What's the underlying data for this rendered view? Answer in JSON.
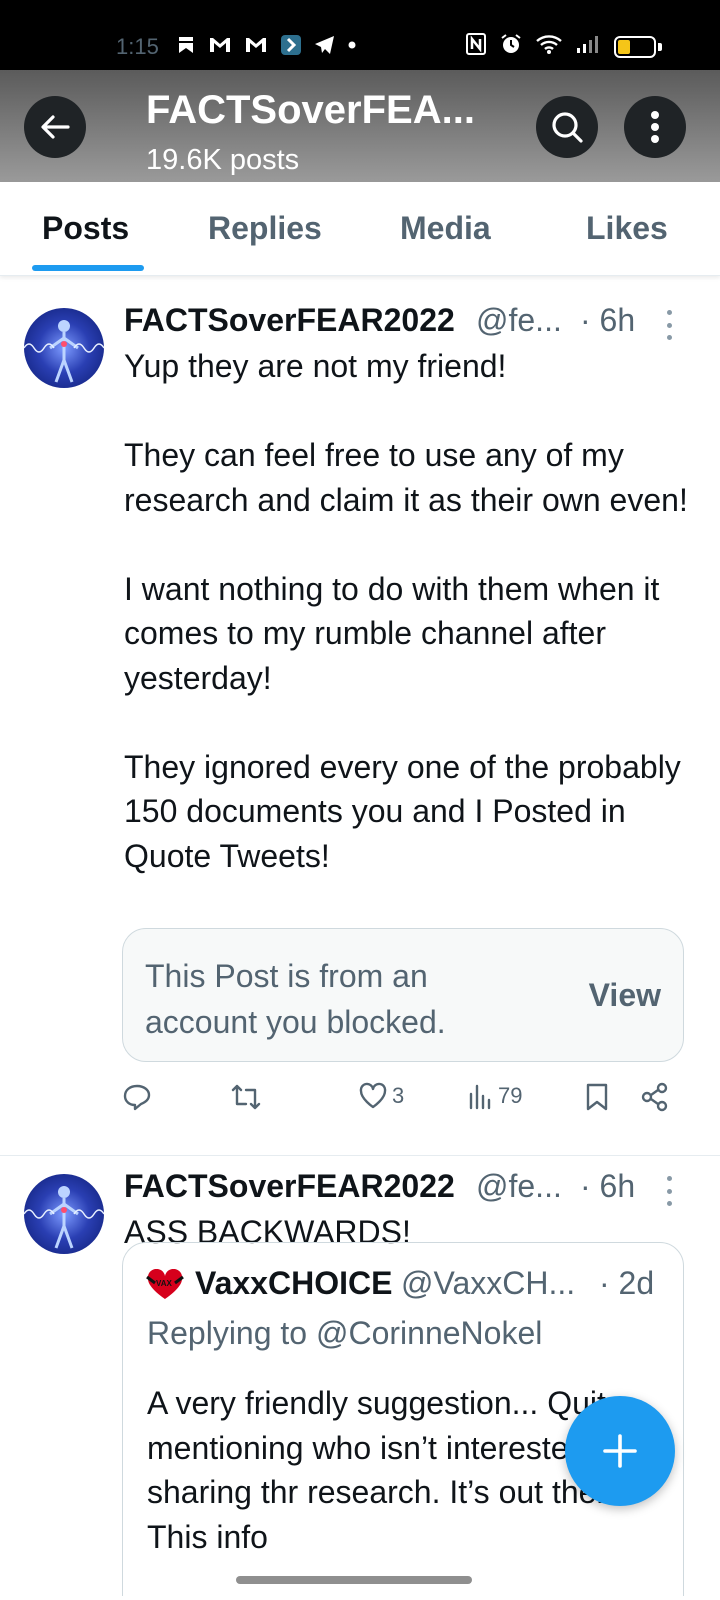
{
  "status_bar": {
    "time": "1:15",
    "left_icons": [
      "bookmark-icon",
      "gmail-icon",
      "gmail-icon",
      "app-icon",
      "telegram-icon",
      "dot-icon"
    ],
    "right_icons": [
      "nfc-icon",
      "alarm-icon",
      "wifi-icon",
      "signal-icon",
      "battery-icon"
    ],
    "battery_color": "#f5c518"
  },
  "header": {
    "title": "FACTSoverFEA...",
    "subtitle": "19.6K posts"
  },
  "tabs": [
    {
      "label": "Posts",
      "active": true
    },
    {
      "label": "Replies",
      "active": false
    },
    {
      "label": "Media",
      "active": false
    },
    {
      "label": "Likes",
      "active": false
    }
  ],
  "posts": [
    {
      "display_name": "FACTSoverFEAR2022",
      "handle": "@fe...",
      "time": "· 6h",
      "paragraphs": [
        "Yup they are not my friend!",
        "They can feel free to use any of my research and claim it as their own even!",
        "I want nothing to do with them when it comes to my rumble channel after yesterday!",
        "They ignored every one of the probably 150 documents you and I Posted in Quote Tweets!"
      ],
      "blocked_card": {
        "text": "This Post is from an account you blocked.",
        "action": "View"
      },
      "actions": {
        "reply": "",
        "repost": "",
        "likes": "3",
        "views": "79"
      }
    },
    {
      "display_name": "FACTSoverFEAR2022",
      "handle": "@fe...",
      "time": "· 6h",
      "text": "ASS BACKWARDS!",
      "quote": {
        "display_name": "VaxxCHOICE",
        "handle": "@VaxxCH...",
        "time": "· 2d",
        "replying_to": "Replying to @CorinneNokel",
        "text": "A very friendly suggestion... Quit mentioning who isn’t interested in sharing thr research. It’s out there. This info"
      }
    }
  ],
  "colors": {
    "accent": "#1d9bf0",
    "secondary_text": "#536471",
    "primary_text": "#0f1419"
  }
}
